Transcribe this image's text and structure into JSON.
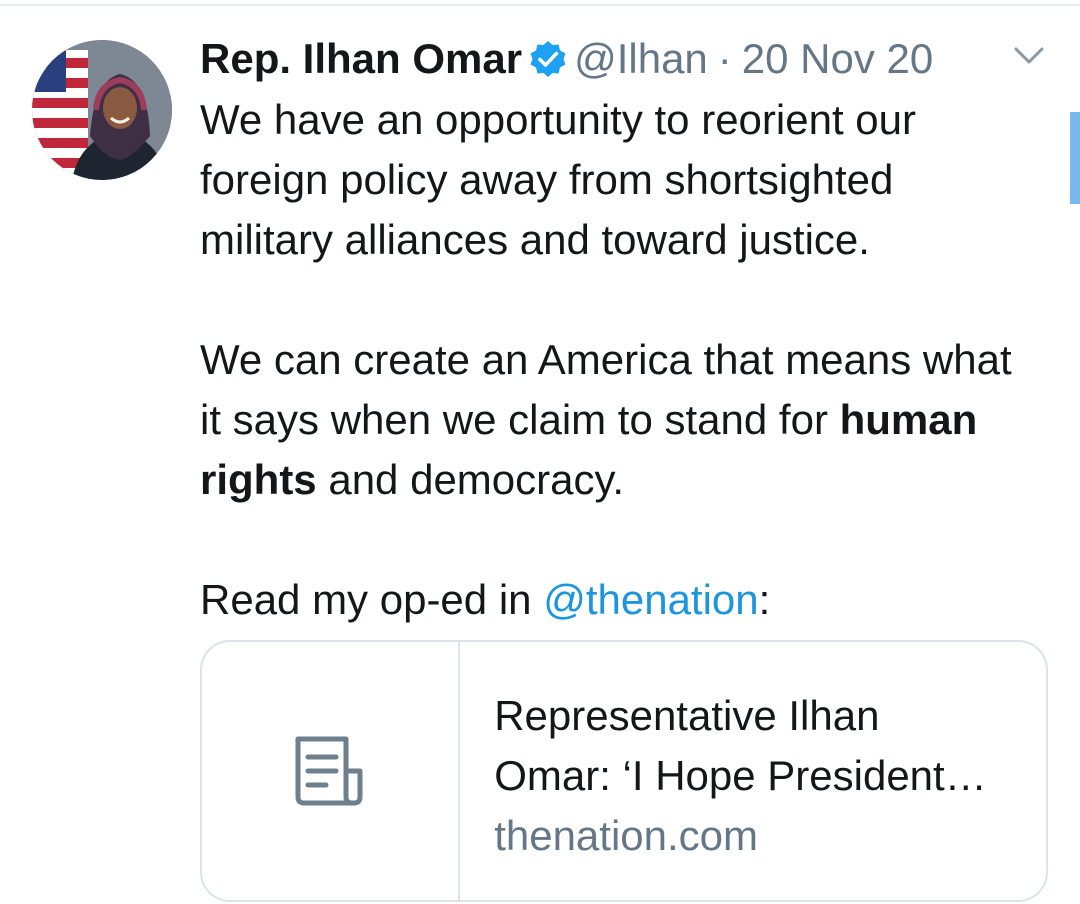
{
  "tweet": {
    "author": {
      "name": "Rep. Ilhan Omar",
      "handle": "@Ilhan",
      "verified": true,
      "avatar_icon": "profile-photo"
    },
    "separator": "·",
    "timestamp": "20 Nov 20",
    "menu_icon": "chevron-down-icon",
    "paragraph1": "We have an opportunity to reorient our foreign policy away from shortsighted military alliances and toward justice.",
    "paragraph2": {
      "before_line3": "We can create an America that means what it says when we claim to stand for",
      "bold": "human rights",
      "after_bold": "and democracy."
    },
    "paragraph3": {
      "prefix": "Read my op-ed in",
      "mention": "@thenation",
      "suffix": ":"
    },
    "link_card": {
      "thumbnail_icon": "document-icon",
      "title_line1": "Representative Ilhan",
      "title_line2": "Omar: ‘I Hope President…",
      "domain": "thenation.com"
    }
  },
  "colors": {
    "text": "#14171a",
    "secondary": "#657786",
    "link": "#1b95e0",
    "verified": "#1da1f2",
    "border": "#dde3e8",
    "scroll_indicator": "#79b9ec"
  }
}
